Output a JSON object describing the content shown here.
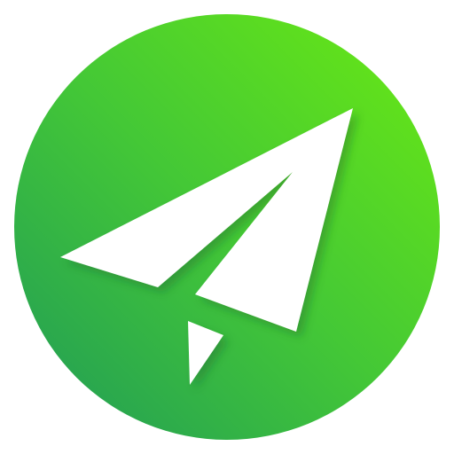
{
  "app_icon": {
    "icon_name": "paper-plane-icon",
    "colors": {
      "gradient_start": "#6BEA12",
      "gradient_mid": "#44C836",
      "gradient_end": "#1F9A58",
      "glyph": "#FFFFFF",
      "shadow": "#1A5A2A"
    }
  }
}
